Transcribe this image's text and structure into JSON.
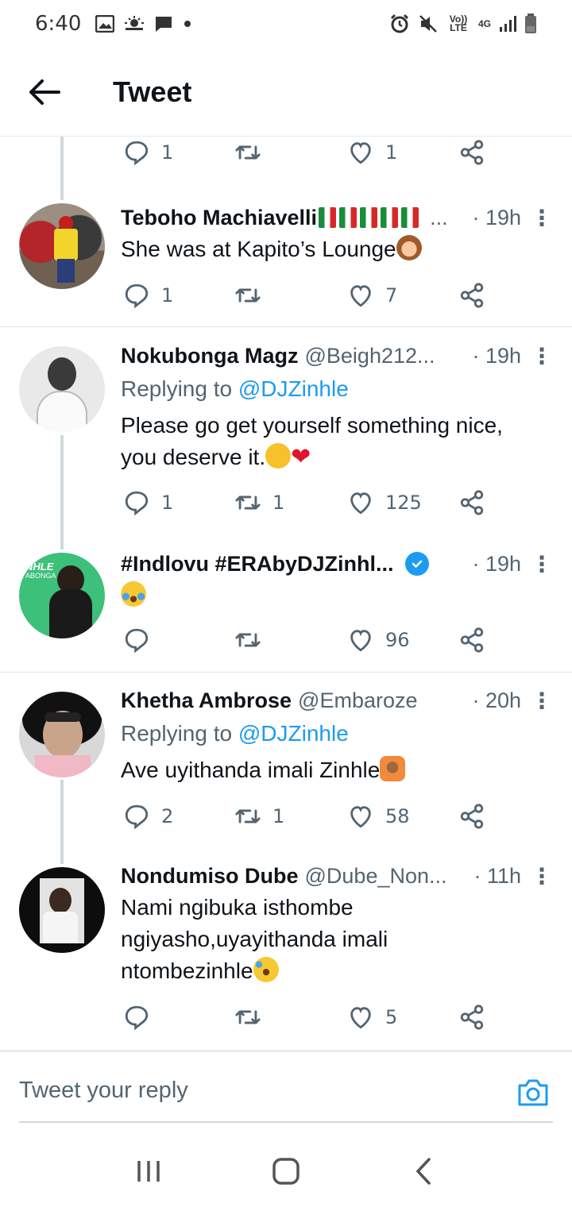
{
  "status_bar": {
    "time": "6:40",
    "left_icons": [
      "image-icon",
      "weather-icon",
      "message-icon",
      "dot-icon"
    ],
    "right_icons": [
      "alarm-icon",
      "mute-icon",
      "volte-icon",
      "network-4g-icon",
      "signal-icon",
      "battery-icon"
    ],
    "volte_label": "Vo)) LTE",
    "network_label": "4G"
  },
  "header": {
    "title": "Tweet"
  },
  "top_actions": {
    "replies": "1",
    "retweets": "",
    "likes": "1"
  },
  "tweets": [
    {
      "name": "Teboho Machiavelli",
      "handle": "...",
      "time": "· 19h",
      "replying_prefix": "",
      "replying_to": "",
      "text": "She was at Kapito’s Lounge",
      "replies": "1",
      "retweets": "",
      "likes": "7"
    },
    {
      "name": "Nokubonga Magz",
      "handle": "@Beigh212...",
      "time": "· 19h",
      "replying_prefix": "Replying to",
      "replying_to": "@DJZinhle",
      "text": "Please go get yourself something nice, you deserve it.",
      "replies": "1",
      "retweets": "1",
      "likes": "125"
    },
    {
      "name": "#Indlovu #ERAbyDJZinhl...",
      "handle": "",
      "time": "· 19h",
      "replying_prefix": "",
      "replying_to": "",
      "text": "",
      "replies": "",
      "retweets": "",
      "likes": "96"
    },
    {
      "name": "Khetha Ambrose",
      "handle": "@Embaroze",
      "time": "· 20h",
      "replying_prefix": "Replying to",
      "replying_to": "@DJZinhle",
      "text": "Ave uyithanda imali Zinhle",
      "replies": "2",
      "retweets": "1",
      "likes": "58"
    },
    {
      "name": "Nondumiso Dube",
      "handle": "@Dube_Non...",
      "time": "· 11h",
      "replying_prefix": "",
      "replying_to": "",
      "text": "Nami ngibuka isthombe ngiyasho,uyayithanda imali ntombezinhle",
      "replies": "",
      "retweets": "",
      "likes": "5"
    }
  ],
  "avatar_3_text": {
    "top": "NHLE",
    "sub": "ABONGA"
  },
  "reply_bar": {
    "placeholder": "Tweet your reply"
  },
  "colors": {
    "accent": "#1d9bf0",
    "text_secondary": "#536471",
    "thread_line": "#cfd9de"
  }
}
